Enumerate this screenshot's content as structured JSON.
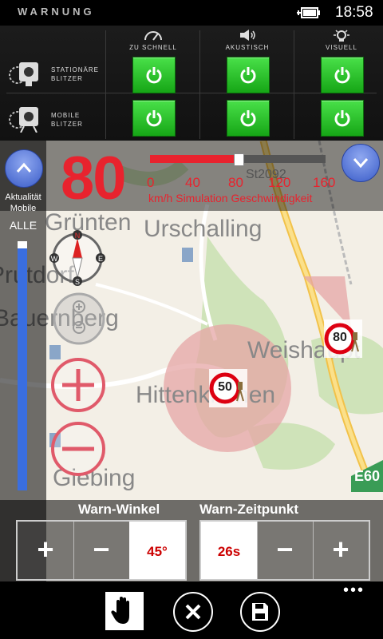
{
  "status": {
    "time": "18:58"
  },
  "warnings": {
    "title": "WARNUNG",
    "columns": [
      {
        "label": "ZU SCHNELL",
        "icon": "speedometer-icon"
      },
      {
        "label": "AKUSTISCH",
        "icon": "speaker-icon"
      },
      {
        "label": "VISUELL",
        "icon": "lightbulb-icon"
      }
    ],
    "rows": [
      {
        "line1": "STATIONÄRE",
        "line2": "BLITZER",
        "icon": "stationary-camera-icon"
      },
      {
        "line1": "MOBILE",
        "line2": "BLITZER",
        "icon": "mobile-camera-icon"
      }
    ],
    "active_color": "#22c222"
  },
  "simulation": {
    "speed": "80",
    "speed_fraction": 0.5,
    "ticks": [
      "0",
      "40",
      "80",
      "120",
      "160"
    ],
    "label": "km/h Simulation Geschwindigkeit",
    "accent": "#e8232e"
  },
  "sidebar": {
    "aktual_line1": "Aktualität",
    "aktual_line2": "Mobile",
    "filter": "ALLE",
    "level_fraction": 0.97
  },
  "map": {
    "places": [
      "Urschalling",
      "Prutdorf",
      "Bauernberg",
      "Hittenkirchen",
      "Weishaupt",
      "Giebing",
      "Grünten"
    ],
    "road_label": "E60",
    "street_label": "St2092",
    "cameras": [
      {
        "speed": "50",
        "type": "stationary"
      },
      {
        "speed": "80",
        "type": "stationary"
      }
    ],
    "compass_n": "N",
    "compass_s": "S",
    "compass_e": "E",
    "compass_w": "W"
  },
  "controls": {
    "angle": {
      "title": "Warn-Winkel",
      "value": "45°",
      "plus": "+",
      "minus": "−"
    },
    "time": {
      "title": "Warn-Zeitpunkt",
      "value": "26s",
      "plus": "+",
      "minus": "−"
    }
  },
  "appbar": {
    "more": "•••"
  }
}
